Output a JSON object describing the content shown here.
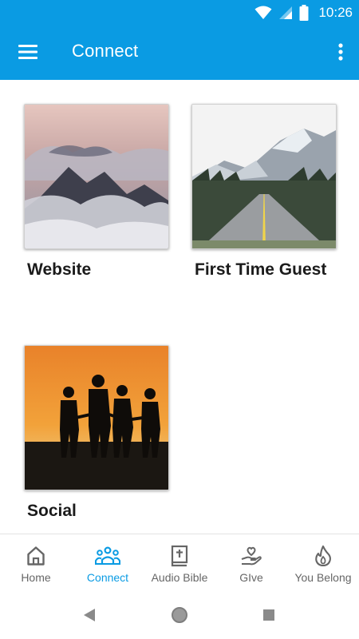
{
  "status_bar": {
    "time": "10:26"
  },
  "app_bar": {
    "title": "Connect"
  },
  "cards": [
    {
      "label": "Website"
    },
    {
      "label": "First Time Guest"
    },
    {
      "label": "Social"
    }
  ],
  "bottom_nav": {
    "items": [
      {
        "label": "Home",
        "icon": "home-icon"
      },
      {
        "label": "Connect",
        "icon": "people-group-icon",
        "active": true
      },
      {
        "label": "Audio Bible",
        "icon": "bible-icon"
      },
      {
        "label": "GIve",
        "icon": "giving-hand-icon"
      },
      {
        "label": "You Belong",
        "icon": "flame-icon"
      }
    ]
  },
  "colors": {
    "accent": "#0a9be3",
    "nav_inactive": "#666666",
    "label": "#1b1b1b"
  }
}
